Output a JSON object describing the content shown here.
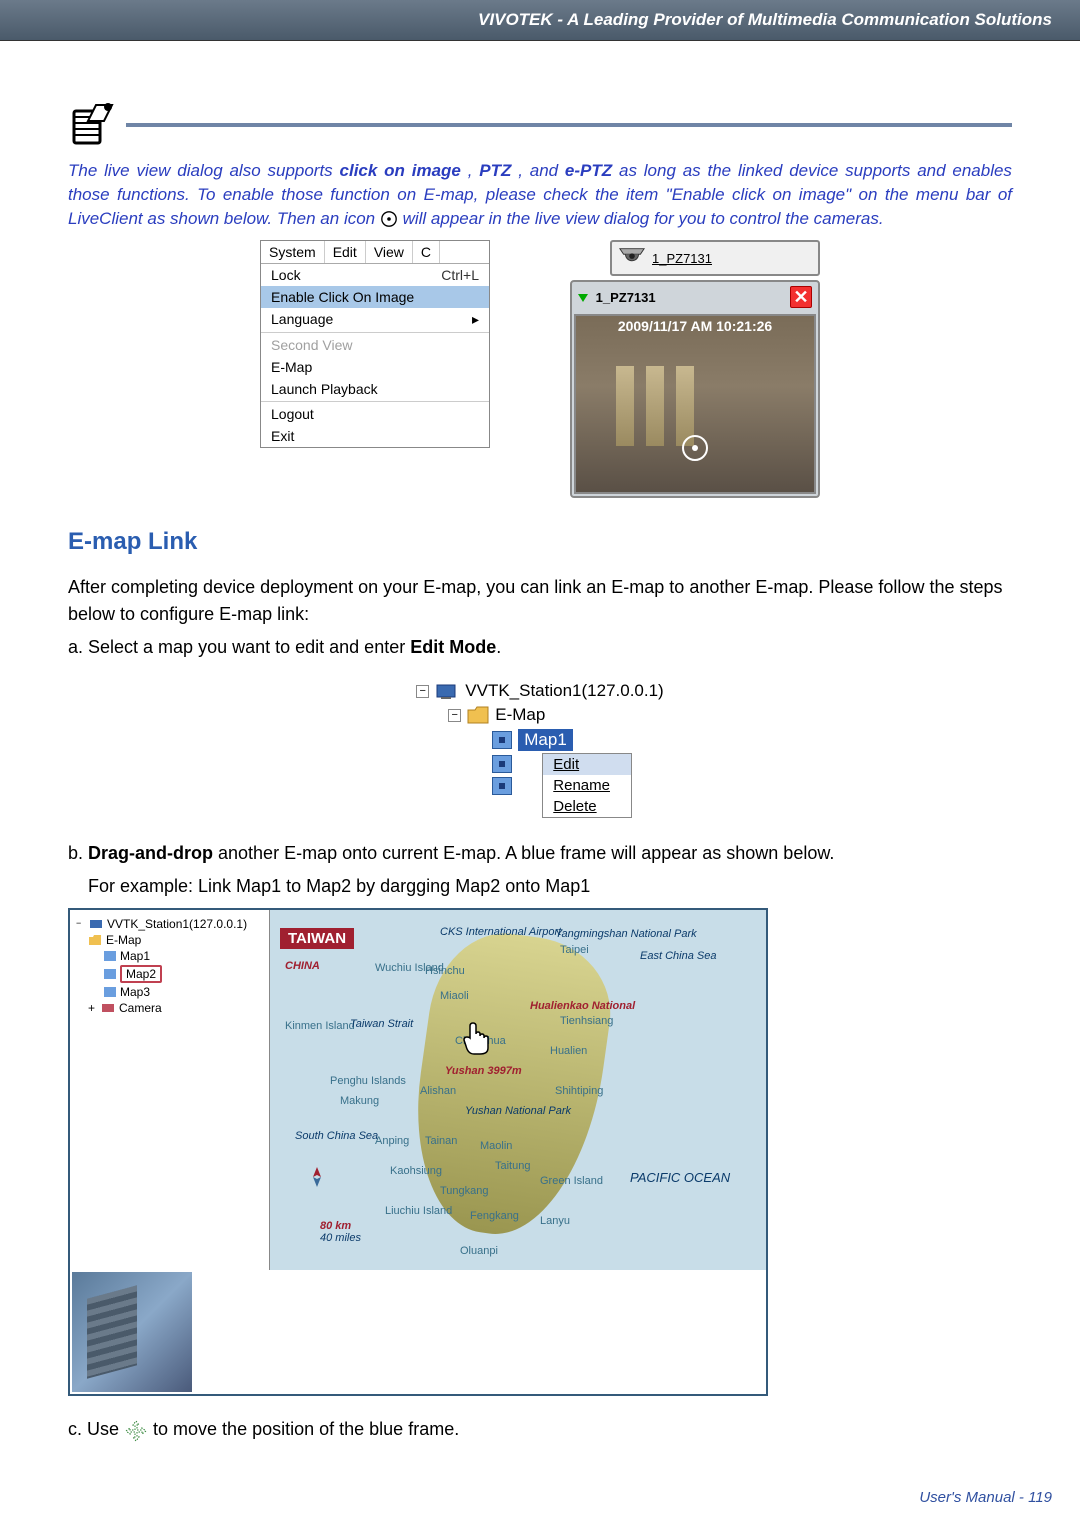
{
  "header": "VIVOTEK - A Leading Provider of Multimedia Communication Solutions",
  "note": {
    "p1a": "The live view dialog also supports ",
    "s1": "click on image",
    "p1b": ", ",
    "s2": "PTZ",
    "p1c": ", and ",
    "s3": "e-PTZ",
    "p1d": " as long as the linked device supports and enables those functions. To enable those function on E-map, please check the item \"Enable click on image\" on the menu bar of LiveClient as shown below. Then an icon ",
    "p1e": " will appear in the live view dialog for you to control the cameras."
  },
  "menu": {
    "tabs": [
      "System",
      "Edit",
      "View",
      "C"
    ],
    "lock": "Lock",
    "lock_sc": "Ctrl+L",
    "enable_click": "Enable Click On Image",
    "language": "Language",
    "second_view": "Second View",
    "emap": "E-Map",
    "playback": "Launch Playback",
    "logout": "Logout",
    "exit": "Exit"
  },
  "live": {
    "camera_label": "1_PZ7131",
    "panel_label": "1_PZ7131",
    "timestamp": "2009/11/17 AM 10:21:26"
  },
  "section": {
    "heading": "E-map Link",
    "intro": "After completing device deployment on your E-map, you can link an E-map to another E-map. Please follow the steps below to configure E-map link:",
    "step_a": "a. Select a map you want to edit and enter ",
    "step_a_bold": "Edit Mode",
    "step_a_end": "."
  },
  "tree": {
    "station": "VVTK_Station1(127.0.0.1)",
    "emap": "E-Map",
    "map1": "Map1",
    "ctx_edit": "Edit",
    "ctx_rename": "Rename",
    "ctx_delete": "Delete"
  },
  "step_b": {
    "pre": "b. ",
    "bold": "Drag-and-drop",
    "post": " another E-map onto current E-map. A blue frame will appear as shown below.",
    "line2": "For example: Link Map1 to Map2 by dargging Map2 onto Map1"
  },
  "side_tree": {
    "station": "VVTK_Station1(127.0.0.1)",
    "emap": "E-Map",
    "map1": "Map1",
    "map2": "Map2",
    "map3": "Map3",
    "camera": "Camera"
  },
  "map": {
    "title_box": "TAIWAN",
    "china": "CHINA",
    "cks": "CKS International Airport",
    "yangmin": "Yangmingshan National Park",
    "taipei": "Taipei",
    "east_sea": "East China Sea",
    "wuchiu": "Wuchiu Island",
    "hsinchu": "Hsinchu",
    "miaoli": "Miaoli",
    "hualien_park": "Hualienkao National",
    "tienhsiang": "Tienhsiang",
    "kinmen": "Kinmen Island",
    "taiwan_strait": "Taiwan Strait",
    "changhua": "Changhua",
    "hualien": "Hualien",
    "penghu": "Penghu Islands",
    "makung": "Makung",
    "yushan": "Yushan 3997m",
    "alishan": "Alishan",
    "shihtiping": "Shihtiping",
    "yushan_park": "Yushan National Park",
    "south_sea": "South China Sea",
    "anping": "Anping",
    "tainan": "Tainan",
    "maolin": "Maolin",
    "taitung": "Taitung",
    "kaohsiung": "Kaohsiung",
    "green": "Green Island",
    "tungkang": "Tungkang",
    "pacific": "PACIFIC OCEAN",
    "liuchiu": "Liuchiu Island",
    "fengkang": "Fengkang",
    "lanyu": "Lanyu",
    "scale_km": "80 km",
    "scale_mi": "40 miles",
    "oluanpi": "Oluanpi"
  },
  "step_c": {
    "pre": "c. Use ",
    "post": " to move the position of the blue frame."
  },
  "footer": "User's Manual - 119"
}
